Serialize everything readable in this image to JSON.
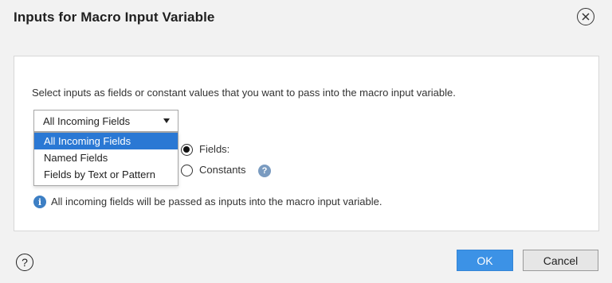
{
  "dialog": {
    "title": "Inputs for Macro Input Variable"
  },
  "content": {
    "description": "Select inputs as fields or constant values that you want to pass into the macro input variable.",
    "select": {
      "value": "All Incoming Fields",
      "options": [
        "All Incoming Fields",
        "Named Fields",
        "Fields by Text or Pattern"
      ],
      "highlighted_index": 0
    },
    "radio_fields_label": "Fields:",
    "radio_constants_label": "Constants",
    "radio_selected": "Fields:",
    "info_text": "All incoming fields will be passed as inputs into the macro input variable."
  },
  "footer": {
    "ok_label": "OK",
    "cancel_label": "Cancel"
  },
  "icons": {
    "close": "close-icon",
    "help_circle": "help-icon",
    "constants_help": "help-icon",
    "info": "info-icon"
  },
  "colors": {
    "ok_button": "#3c92e6",
    "menu_highlight": "#2a78d4",
    "info_icon": "#3d7fc4",
    "help_icon": "#7a9bc0"
  }
}
